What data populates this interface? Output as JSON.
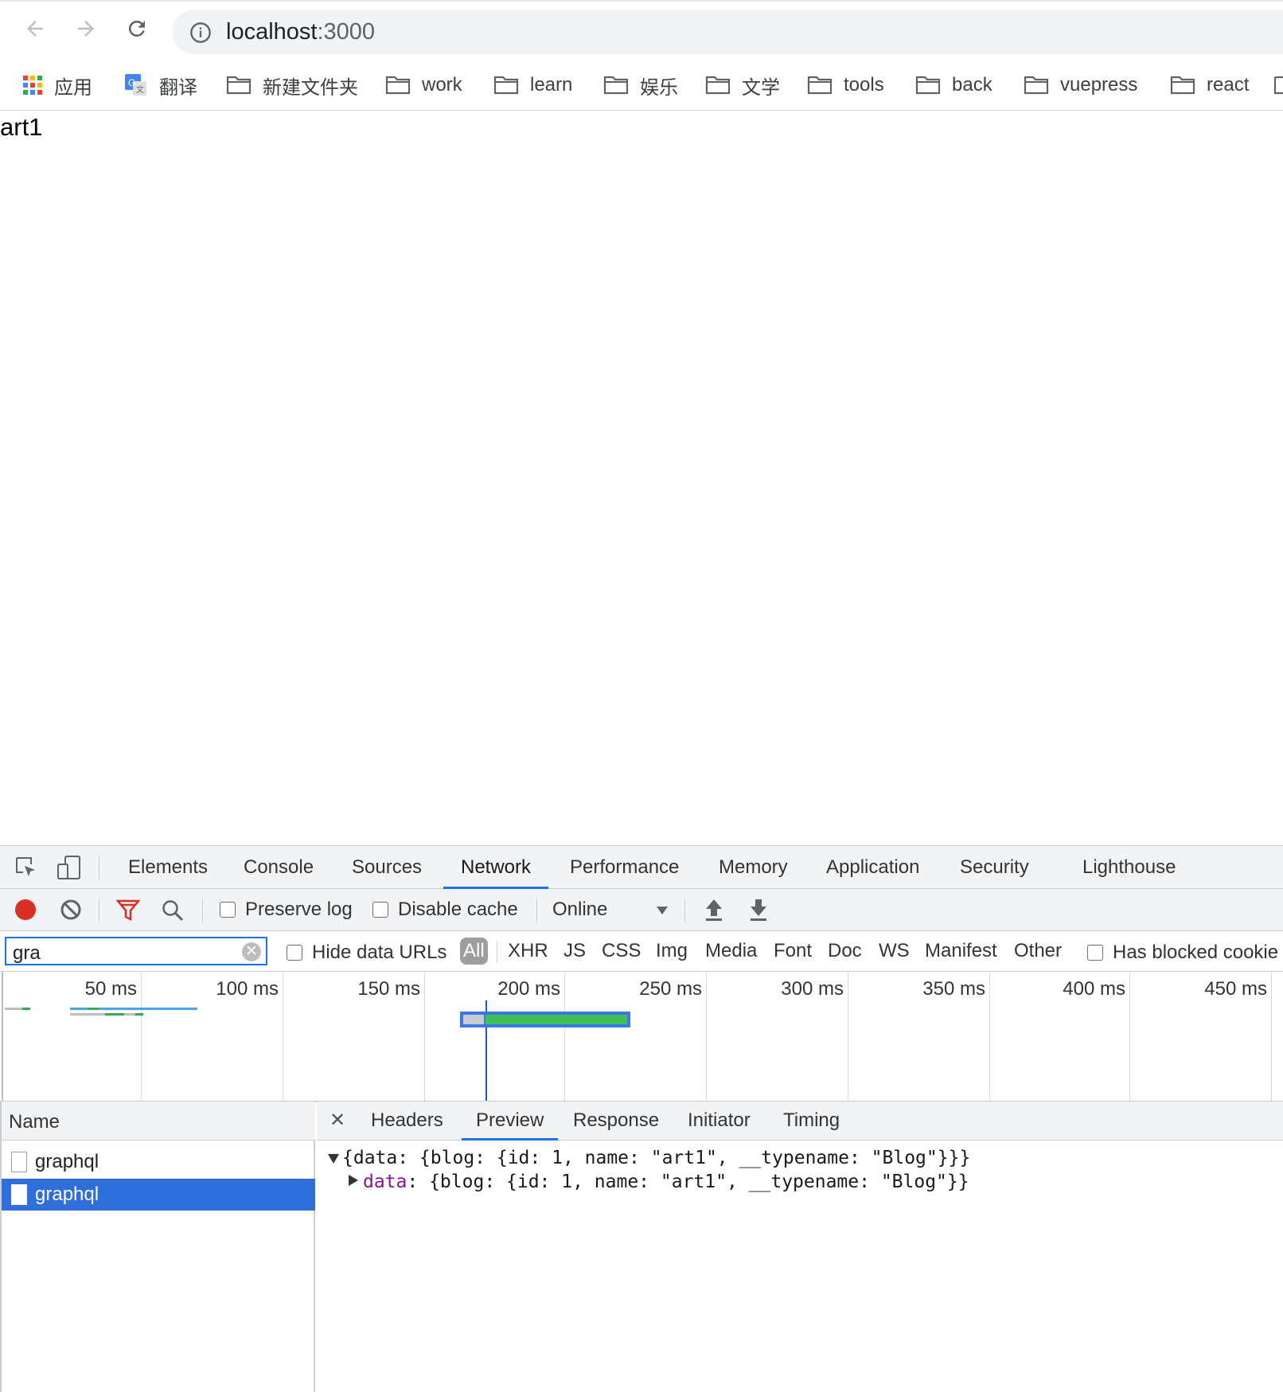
{
  "browser": {
    "url_host": "localhost",
    "url_port": ":3000"
  },
  "bookmarks": [
    {
      "label": "应用",
      "icon": "apps-grid-icon"
    },
    {
      "label": "翻译",
      "icon": "google-translate-icon"
    },
    {
      "label": "新建文件夹",
      "icon": "folder-icon"
    },
    {
      "label": "work",
      "icon": "folder-icon"
    },
    {
      "label": "learn",
      "icon": "folder-icon"
    },
    {
      "label": "娱乐",
      "icon": "folder-icon"
    },
    {
      "label": "文学",
      "icon": "folder-icon"
    },
    {
      "label": "tools",
      "icon": "folder-icon"
    },
    {
      "label": "back",
      "icon": "folder-icon"
    },
    {
      "label": "vuepress",
      "icon": "folder-icon"
    },
    {
      "label": "react",
      "icon": "folder-icon"
    }
  ],
  "page": {
    "text": "art1"
  },
  "devtools": {
    "tabs": [
      "Elements",
      "Console",
      "Sources",
      "Network",
      "Performance",
      "Memory",
      "Application",
      "Security",
      "Lighthouse"
    ],
    "active_tab": "Network",
    "controls": {
      "preserve_log": "Preserve log",
      "disable_cache": "Disable cache",
      "throttle": "Online"
    },
    "filter": {
      "value": "gra",
      "hide_data_urls": "Hide data URLs",
      "types": [
        "All",
        "XHR",
        "JS",
        "CSS",
        "Img",
        "Media",
        "Font",
        "Doc",
        "WS",
        "Manifest",
        "Other"
      ],
      "has_blocked": "Has blocked cookie"
    },
    "timeline": {
      "ticks": [
        "50 ms",
        "100 ms",
        "150 ms",
        "200 ms",
        "250 ms",
        "300 ms",
        "350 ms",
        "400 ms",
        "450 ms"
      ]
    },
    "requests": {
      "header": "Name",
      "items": [
        {
          "name": "graphql",
          "selected": false
        },
        {
          "name": "graphql",
          "selected": true
        }
      ]
    },
    "detail": {
      "tabs": [
        "Headers",
        "Preview",
        "Response",
        "Initiator",
        "Timing"
      ],
      "active": "Preview",
      "line1": "{data: {blog: {id: 1, name: \"art1\", __typename: \"Blog\"}}}",
      "line2_key": "data",
      "line2_rest": ": {blog: {id: 1, name: \"art1\", __typename: \"Blog\"}}"
    }
  }
}
